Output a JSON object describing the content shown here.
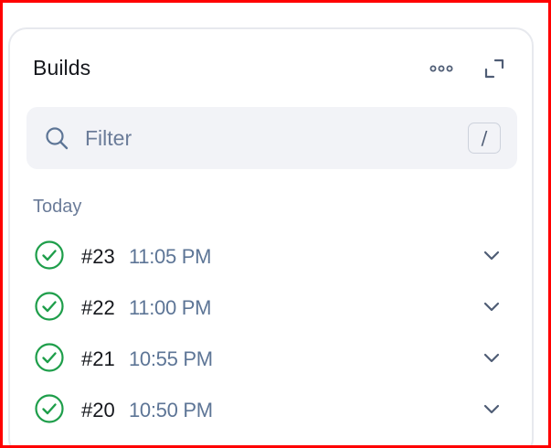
{
  "panel": {
    "title": "Builds",
    "more_icon": "more-horizontal-icon",
    "expand_icon": "expand-icon"
  },
  "filter": {
    "placeholder": "Filter",
    "value": "",
    "shortcut": "/",
    "icon": "search-icon"
  },
  "section": {
    "label": "Today"
  },
  "builds": [
    {
      "number": "#23",
      "time": "11:05 PM",
      "status": "success"
    },
    {
      "number": "#22",
      "time": "11:00 PM",
      "status": "success"
    },
    {
      "number": "#21",
      "time": "10:55 PM",
      "status": "success"
    },
    {
      "number": "#20",
      "time": "10:50 PM",
      "status": "success"
    }
  ],
  "colors": {
    "success": "#1e9e4a",
    "muted": "#6b7c99",
    "frame": "#ff0000"
  }
}
